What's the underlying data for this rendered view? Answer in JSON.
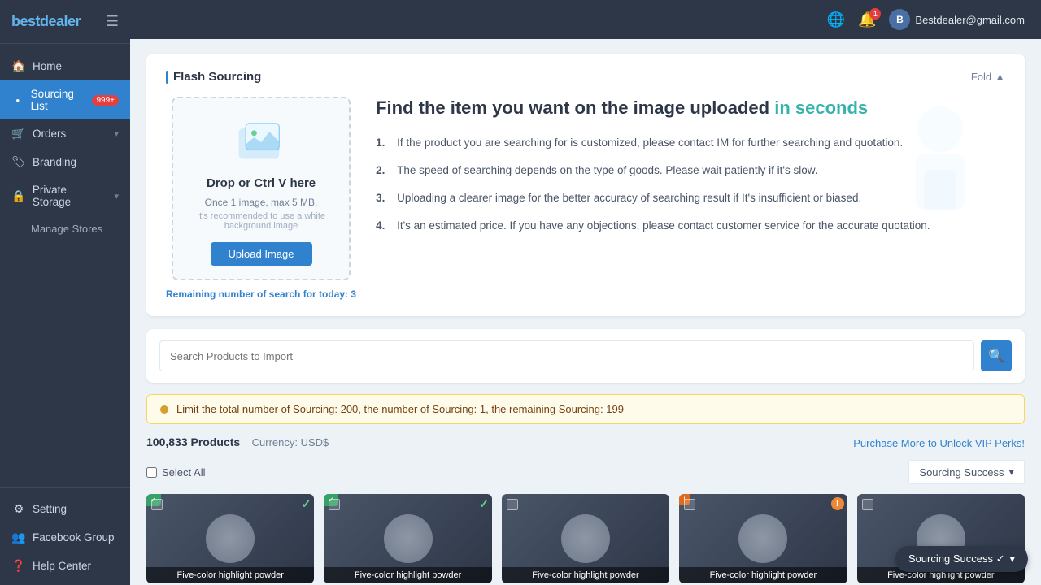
{
  "app": {
    "name": "bestdealer",
    "name_styled": "best",
    "name_styled2": "dealer"
  },
  "header": {
    "user_email": "Bestdealer@gmail.com",
    "notification_count": "1"
  },
  "sidebar": {
    "nav_items": [
      {
        "id": "home",
        "label": "Home",
        "icon": "🏠",
        "active": false
      },
      {
        "id": "sourcing",
        "label": "Sourcing List",
        "icon": "●",
        "active": true,
        "badge": "999+"
      },
      {
        "id": "orders",
        "label": "Orders",
        "icon": "🛒",
        "active": false,
        "arrow": "▾"
      },
      {
        "id": "branding",
        "label": "Branding",
        "icon": "🏷",
        "active": false
      },
      {
        "id": "private-storage",
        "label": "Private Storage",
        "icon": "🔒",
        "active": false,
        "arrow": "▾"
      },
      {
        "id": "manage-stores",
        "label": "Manage Stores",
        "icon": "🏪",
        "active": false
      }
    ],
    "bottom_items": [
      {
        "id": "setting",
        "label": "Setting",
        "icon": "⚙"
      },
      {
        "id": "facebook",
        "label": "Facebook Group",
        "icon": "👥"
      },
      {
        "id": "help",
        "label": "Help Center",
        "icon": "❓"
      }
    ]
  },
  "flash_sourcing": {
    "title": "Flash Sourcing",
    "fold_label": "Fold",
    "heading_main": "Find the item you want on the image uploaded",
    "heading_highlight": "in seconds",
    "upload": {
      "drop_text": "Drop or Ctrl V here",
      "hint1": "Once 1 image, max 5 MB.",
      "hint2": "It's recommended to use a white background image",
      "button_label": "Upload Image"
    },
    "remaining_label": "Remaining number of search for today:",
    "remaining_count": "3",
    "instructions": [
      "If the product you are searching for is customized, please contact IM for further searching and quotation.",
      "The speed of searching depends on the type of goods. Please wait patiently if it's slow.",
      "Uploading a clearer image for the better accuracy of searching result if It's insufficient or biased.",
      "It's an estimated price. If you have any objections, please contact customer service for the accurate quotation."
    ]
  },
  "search": {
    "placeholder": "Search Products to Import"
  },
  "warning": {
    "text": "Limit the total number of Sourcing: 200, the number of Sourcing: 1, the remaining Sourcing: 199"
  },
  "products": {
    "count": "100,833 Products",
    "currency": "Currency: USD$",
    "vip_link": "Purchase More to Unlock VIP Perks!",
    "select_all_label": "Select All",
    "sourcing_dropdown": "Sourcing Success",
    "items": [
      {
        "label": "Five-color highlight powder",
        "badge_type": "green",
        "checked": true
      },
      {
        "label": "Five-color highlight powder",
        "badge_type": "green",
        "checked": true
      },
      {
        "label": "Five-color highlight powder",
        "badge_type": "none",
        "checked": false
      },
      {
        "label": "Five-color highlight powder",
        "badge_type": "orange",
        "warn": true
      },
      {
        "label": "Five-color highlight powder",
        "badge_type": "none",
        "checked": false
      }
    ]
  },
  "sourcing_success_btn": "Sourcing Success ✓"
}
